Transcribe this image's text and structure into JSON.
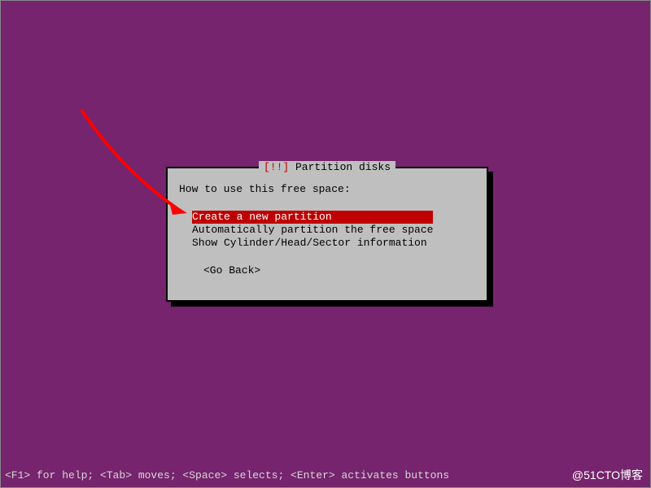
{
  "dialog": {
    "title_marker": "[!!]",
    "title_text": "Partition disks",
    "prompt": "How to use this free space:",
    "menu_items": [
      {
        "label": "Create a new partition",
        "selected": true
      },
      {
        "label": "Automatically partition the free space",
        "selected": false
      },
      {
        "label": "Show Cylinder/Head/Sector information",
        "selected": false
      }
    ],
    "go_back": "<Go Back>"
  },
  "footer": {
    "help_text": "<F1> for help; <Tab> moves; <Space> selects; <Enter> activates buttons"
  },
  "watermark": "@51CTO博客"
}
